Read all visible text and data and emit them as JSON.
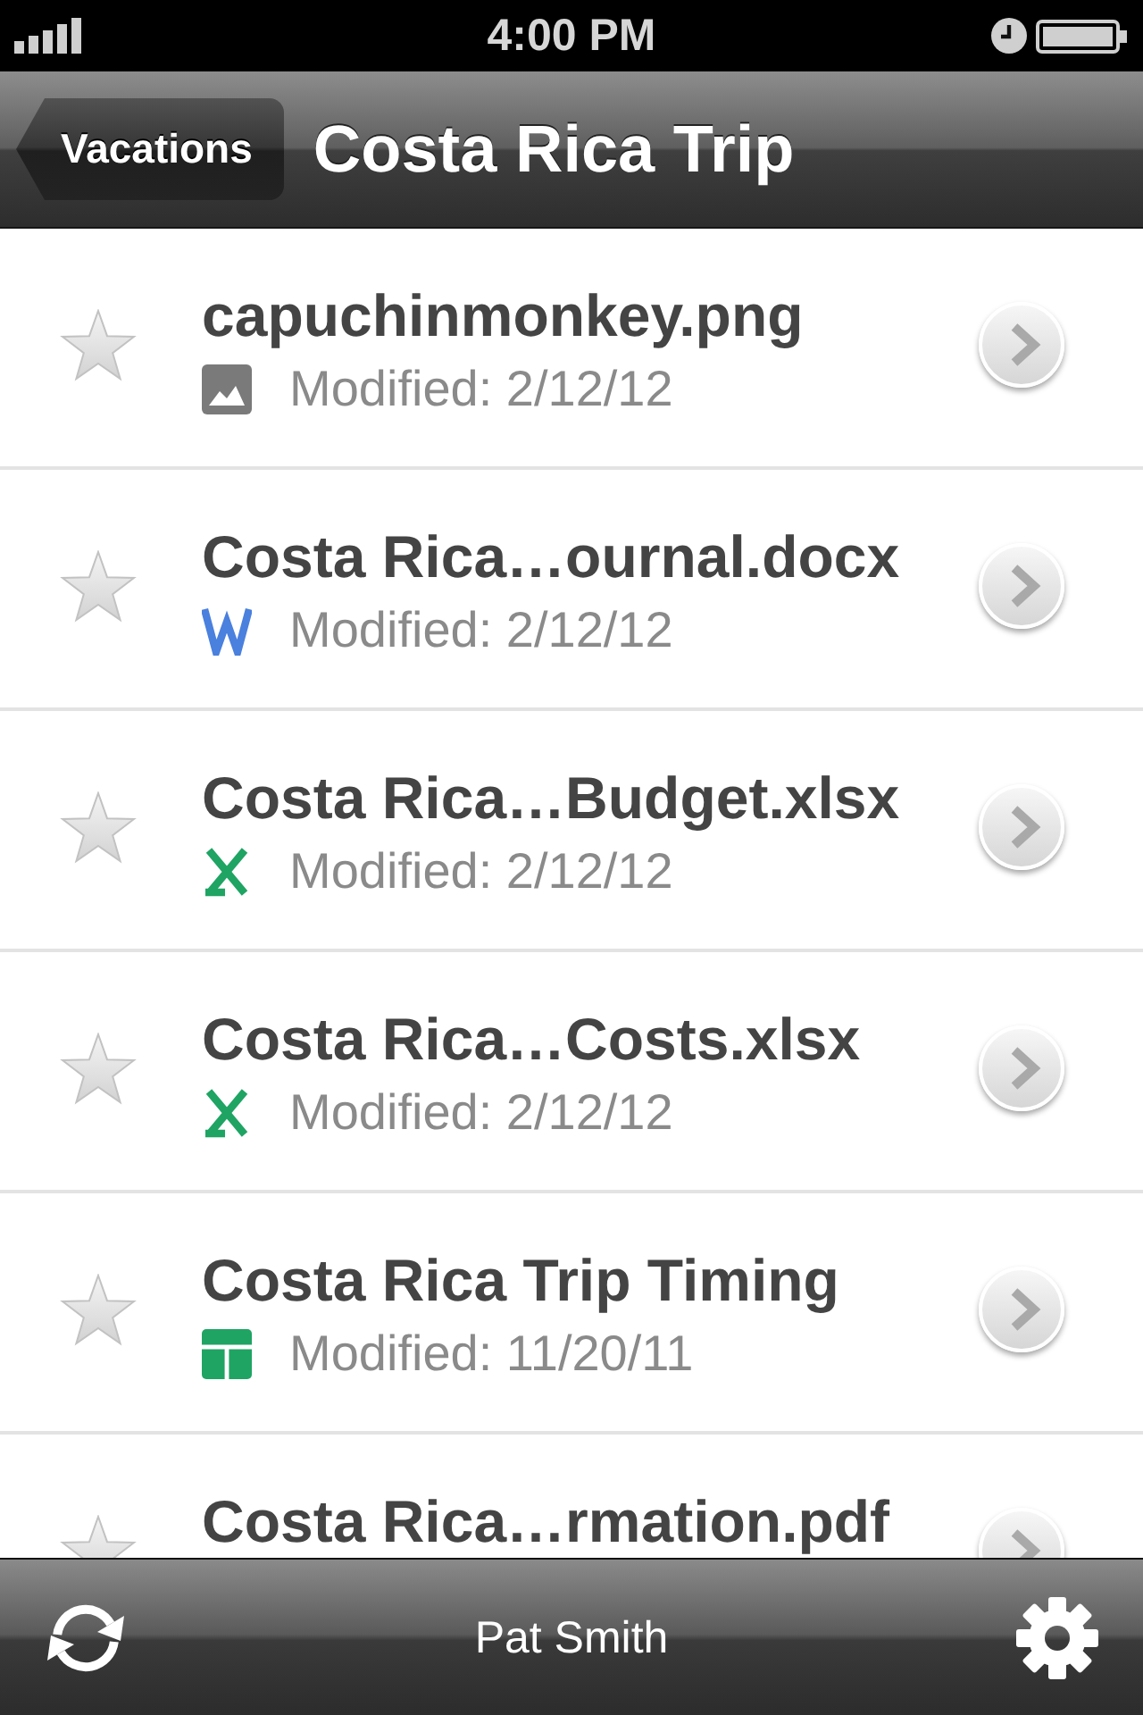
{
  "status_bar": {
    "time": "4:00 PM"
  },
  "nav_bar": {
    "back_button": "Vacations",
    "title": "Costa Rica Trip"
  },
  "files": [
    {
      "name": "capuchinmonkey.png",
      "kind": "image",
      "modified": "Modified: 2/12/12",
      "starred": false
    },
    {
      "name": "Costa Rica…ournal.docx",
      "kind": "document",
      "modified": "Modified: 2/12/12",
      "starred": false
    },
    {
      "name": "Costa Rica…Budget.xlsx",
      "kind": "spreadsheet",
      "modified": "Modified: 2/12/12",
      "starred": false
    },
    {
      "name": "Costa Rica…Costs.xlsx",
      "kind": "spreadsheet",
      "modified": "Modified: 2/12/12",
      "starred": false
    },
    {
      "name": "Costa Rica Trip Timing",
      "kind": "sheet",
      "modified": "Modified: 11/20/11",
      "starred": false
    },
    {
      "name": "Costa Rica…rmation.pdf",
      "starred": false
    }
  ],
  "toolbar": {
    "user": "Pat Smith"
  }
}
